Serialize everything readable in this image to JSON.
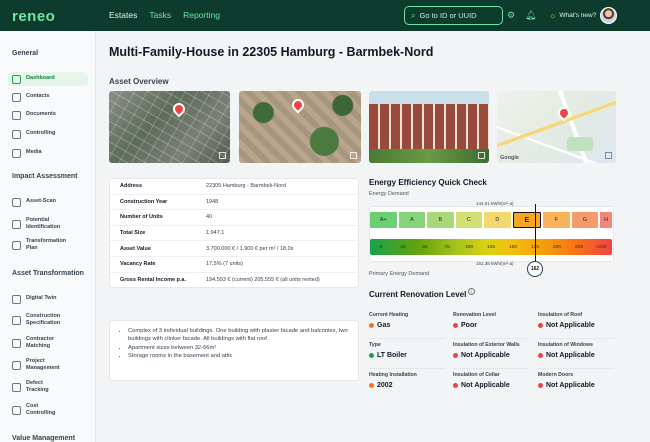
{
  "topbar": {
    "logo": "reneo",
    "nav": [
      "Estates",
      "Tasks",
      "Reporting"
    ],
    "search_placeholder": "Go to ID or UUID",
    "whats_new": "What's new?"
  },
  "sidebar": {
    "sections": [
      {
        "title": "General",
        "items": [
          {
            "label": [
              "Dashboard"
            ],
            "icon": "dashboard-icon",
            "active": true
          },
          {
            "label": [
              "Contacts"
            ],
            "icon": "contacts-icon"
          },
          {
            "label": [
              "Documents"
            ],
            "icon": "documents-icon"
          },
          {
            "label": [
              "Controlling"
            ],
            "icon": "controlling-icon"
          },
          {
            "label": [
              "Media"
            ],
            "icon": "media-icon"
          }
        ]
      },
      {
        "title": "Impact Assessment",
        "items": [
          {
            "label": [
              "Asset-Scan"
            ],
            "icon": "scan-icon"
          },
          {
            "label": [
              "Potential",
              "Identification"
            ],
            "icon": "potential-icon"
          },
          {
            "label": [
              "Transformation",
              "Plan"
            ],
            "icon": "plan-icon"
          }
        ]
      },
      {
        "title": "Asset Transformation",
        "items": [
          {
            "label": [
              "Digital Twin"
            ],
            "icon": "twin-icon"
          },
          {
            "label": [
              "Construction",
              "Specification"
            ],
            "icon": "construction-icon"
          },
          {
            "label": [
              "Contractor",
              "Matching"
            ],
            "icon": "contractor-icon"
          },
          {
            "label": [
              "Project",
              "Management"
            ],
            "icon": "project-icon"
          },
          {
            "label": [
              "Defect",
              "Tracking"
            ],
            "icon": "defect-icon"
          },
          {
            "label": [
              "Cost",
              "Controlling"
            ],
            "icon": "cost-icon"
          }
        ]
      },
      {
        "title": "Value Management",
        "items": []
      }
    ]
  },
  "main": {
    "title": "Multi-Family-House in 22305 Hamburg - Barmbek-Nord",
    "asset_overview": "Asset Overview",
    "details": [
      {
        "k": "Address",
        "v": "22305 Hamburg - Barmbek-Nord"
      },
      {
        "k": "Construction Year",
        "v": "1948"
      },
      {
        "k": "Number of Units",
        "v": "40"
      },
      {
        "k": "Total Size",
        "v": "1.947,1"
      },
      {
        "k": "Asset Value",
        "v": "3.700.000 € / 1.900 € per m² / 18,0x"
      },
      {
        "k": "Vacancy Rate",
        "v": "17,5% (7 units)"
      },
      {
        "k": "Gross Rental Income p.a.",
        "v": "194.593 € (current) 205.555 € (all units rented)"
      }
    ],
    "notes": [
      "Complex of 3 individual buildings. One building with plaster facade and balconies, two buildings with clinker facade. All buildings with flat roof.",
      "Apartment sizes between 32-66m²",
      "Storage rooms in the basement and attic"
    ]
  },
  "energy": {
    "title": "Energy Efficiency Quick Check",
    "energy_demand": "Energy Demand",
    "primary_demand": "Primary Energy Demand",
    "kwh_top": "144,01 kWh/(m²·a)",
    "kwh_bottom": "161,38 kWh/(m²·a)",
    "badge": "162",
    "classes": [
      "A+",
      "A",
      "B",
      "C",
      "D",
      "E",
      "F",
      "G",
      "H"
    ],
    "class_colors": [
      "#6ccf73",
      "#86d37a",
      "#a8d878",
      "#d3df73",
      "#f2d86f",
      "#f5a623",
      "#f7b25a",
      "#f59a6b",
      "#f2867a"
    ],
    "selected_class": "E",
    "scale": [
      "0",
      "25",
      "50",
      "75",
      "100",
      "125",
      "150",
      "175",
      "200",
      "225",
      ">250"
    ]
  },
  "renovation": {
    "title": "Current Renovation Level",
    "items": [
      {
        "label": "Current Heating",
        "value": "Gas",
        "color": "#f97316"
      },
      {
        "label": "Renovation Level",
        "value": "Poor",
        "color": "#ef4444"
      },
      {
        "label": "Insulation of Roof",
        "value": "Not Applicable",
        "color": "#ef4444"
      },
      {
        "label": "Type",
        "value": "LT Boiler",
        "color": "#16a34a"
      },
      {
        "label": "Insulation of Exterior Walls",
        "value": "Not Applicable",
        "color": "#ef4444"
      },
      {
        "label": "Insulation of Windows",
        "value": "Not Applicable",
        "color": "#ef4444"
      },
      {
        "label": "Heating Installation",
        "value": "2002",
        "color": "#f97316"
      },
      {
        "label": "Insulation of Cellar",
        "value": "Not Applicable",
        "color": "#ef4444"
      },
      {
        "label": "Modern Doors",
        "value": "Not Applicable",
        "color": "#ef4444"
      }
    ]
  }
}
